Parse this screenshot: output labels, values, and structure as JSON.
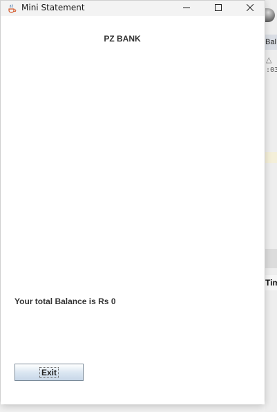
{
  "window": {
    "title": "Mini Statement"
  },
  "header": {
    "bank_name": "PZ BANK"
  },
  "balance": {
    "text": "Your total Balance is Rs 0"
  },
  "actions": {
    "exit_label": "Exit"
  },
  "background_app": {
    "balance_tab_fragment": "Bal",
    "small_text_fragment": ":03",
    "time_header_fragment": "Tim"
  },
  "icons": {
    "app": "java-coffee-icon",
    "minimize": "minimize-icon",
    "maximize": "maximize-icon",
    "close": "close-icon",
    "globe": "globe-icon"
  },
  "colors": {
    "window_bg": "#ffffff",
    "titlebar_bg": "#f3f3f3",
    "text": "#333333",
    "button_border": "#7a8a99"
  }
}
